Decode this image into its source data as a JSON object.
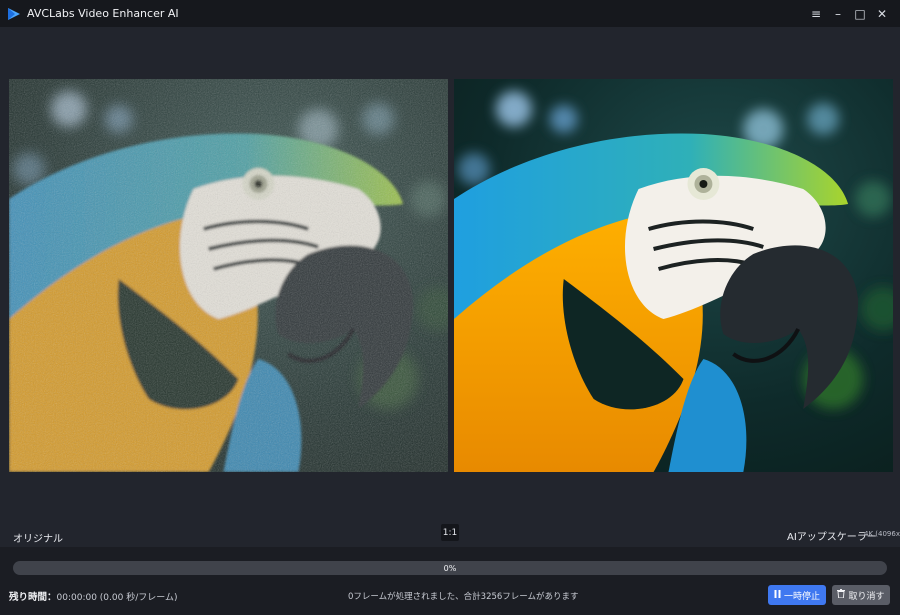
{
  "app": {
    "title": "AVCLabs Video Enhancer AI",
    "accent": "#4b82f1"
  },
  "window_controls": [
    {
      "name": "menu-icon",
      "glyph": "≡"
    },
    {
      "name": "minimize-icon",
      "glyph": "–"
    },
    {
      "name": "maximize-icon",
      "glyph": "□"
    },
    {
      "name": "close-icon",
      "glyph": "✕"
    }
  ],
  "preview": {
    "left_label": "オリジナル",
    "zoom_label": "1:1",
    "right_label": "AIアップスケーラー",
    "right_resolution": "4K (4096x21"
  },
  "progress": {
    "value": 0,
    "text": "0%"
  },
  "status": {
    "remaining_label": "残り時間：",
    "remaining_value": "00:00:00 (0.00 秒/フレーム)",
    "frames_text": "0フレームが処理されました、合計3256フレームがあります"
  },
  "buttons": {
    "pause_label": "一時停止",
    "pause_icon": "pause-icon",
    "cancel_label": "取り消す",
    "cancel_icon": "trash-icon"
  }
}
